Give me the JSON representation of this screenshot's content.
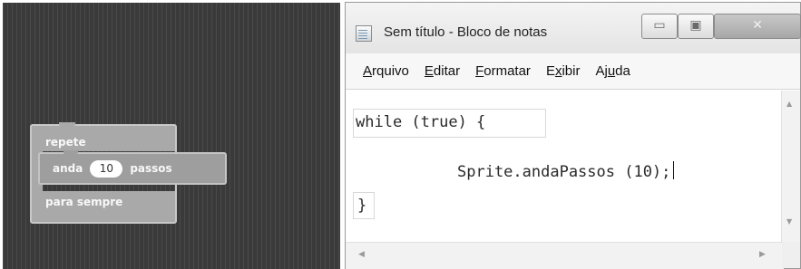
{
  "blocks": {
    "loop_top_label": "repete",
    "loop_bottom_label": "para sempre",
    "move_label_before": "anda",
    "move_steps": "10",
    "move_label_after": "passos"
  },
  "window": {
    "title": "Sem título - Bloco de notas",
    "minimize_glyph": "▭",
    "maximize_glyph": "▣",
    "close_glyph": "✕"
  },
  "menu": {
    "items": [
      {
        "pre": "",
        "key": "A",
        "post": "rquivo"
      },
      {
        "pre": "",
        "key": "E",
        "post": "ditar"
      },
      {
        "pre": "",
        "key": "F",
        "post": "ormatar"
      },
      {
        "pre": "E",
        "key": "x",
        "post": "ibir"
      },
      {
        "pre": "Aj",
        "key": "u",
        "post": "da"
      }
    ]
  },
  "editor": {
    "lines": [
      "while (true) {",
      "Sprite.andaPassos (10);",
      "}"
    ]
  },
  "scroll": {
    "up_arrow": "▲",
    "down_arrow": "▼",
    "left_arrow": "◀",
    "right_arrow": "▶"
  }
}
